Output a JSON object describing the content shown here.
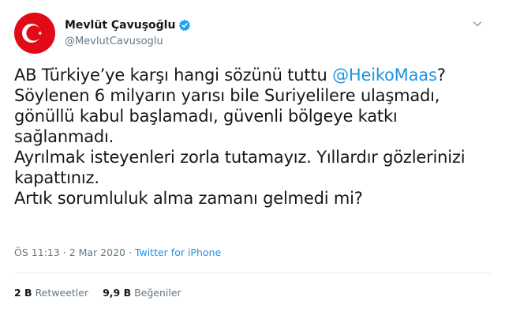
{
  "header": {
    "display_name": "Mevlüt Çavuşoğlu",
    "handle": "@MevlutCavusoglu"
  },
  "tweet": {
    "line1_text": "AB Türkiye’ye karşı hangi sözünü tuttu ",
    "line1_mention": "@HeikoMaas",
    "line1_end": "?",
    "line2": "Söylenen 6 milyarın yarısı bile Suriyelilere ulaşmadı,",
    "line3": "gönüllü kabul başlamadı, güvenli bölgeye katkı",
    "line4": "sağlanmadı.",
    "line5": "Ayrılmak isteyenleri zorla tutamayız. Yıllardır gözlerinizi",
    "line6": "kapattınız.",
    "line7": "Artık sorumluluk alma zamanı gelmedi mi?"
  },
  "meta": {
    "time": "ÖS 11:13",
    "sep1": " · ",
    "date": "2 Mar 2020",
    "sep2": " · ",
    "source": "Twitter for iPhone"
  },
  "stats": {
    "retweets_count": "2 B",
    "retweets_label": "Retweetler",
    "likes_count": "9,9 B",
    "likes_label": "Beğeniler"
  },
  "colors": {
    "link": "#1b95e0",
    "verified": "#1da1f2",
    "avatar_bg": "#e30a17"
  },
  "icons": {
    "verified": "verified-badge-icon",
    "caret": "chevron-down-icon",
    "avatar": "turkish-flag-avatar"
  }
}
